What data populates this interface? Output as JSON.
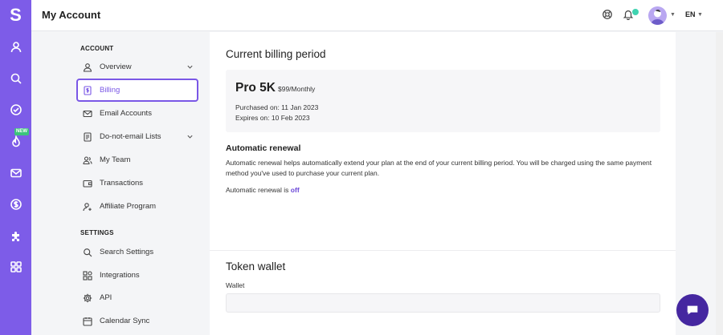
{
  "rail": {
    "logo": "S",
    "new_badge": "NEW",
    "icons": [
      "user-icon",
      "search-icon",
      "check-circle-icon",
      "flame-icon",
      "mail-icon",
      "dollar-icon",
      "puzzle-icon",
      "grid-icon"
    ]
  },
  "header": {
    "title": "My Account",
    "language": "EN"
  },
  "sidebar": {
    "account_label": "ACCOUNT",
    "settings_label": "SETTINGS",
    "account_items": [
      {
        "label": "Overview"
      },
      {
        "label": "Billing"
      },
      {
        "label": "Email Accounts"
      },
      {
        "label": "Do-not-email Lists"
      },
      {
        "label": "My Team"
      },
      {
        "label": "Transactions"
      },
      {
        "label": "Affiliate Program"
      }
    ],
    "settings_items": [
      {
        "label": "Search Settings"
      },
      {
        "label": "Integrations"
      },
      {
        "label": "API"
      },
      {
        "label": "Calendar Sync"
      }
    ]
  },
  "billing": {
    "title": "Current billing period",
    "plan_name": "Pro 5K",
    "plan_price": "$99/Monthly",
    "purchased": "Purchased on: 11 Jan 2023",
    "expires": "Expires on: 10 Feb 2023",
    "renewal_title": "Automatic renewal",
    "renewal_desc": "Automatic renewal helps automatically extend your plan at the end of your current billing period. You will be charged using the same payment method you've used to purchase your current plan.",
    "renewal_status_prefix": "Automatic renewal is",
    "renewal_status_value": "off"
  },
  "wallet": {
    "title": "Token wallet",
    "label": "Wallet",
    "value": ""
  },
  "colors": {
    "accent": "#7d5ce8",
    "chat": "#4527a0",
    "badge": "#3cc47c"
  }
}
